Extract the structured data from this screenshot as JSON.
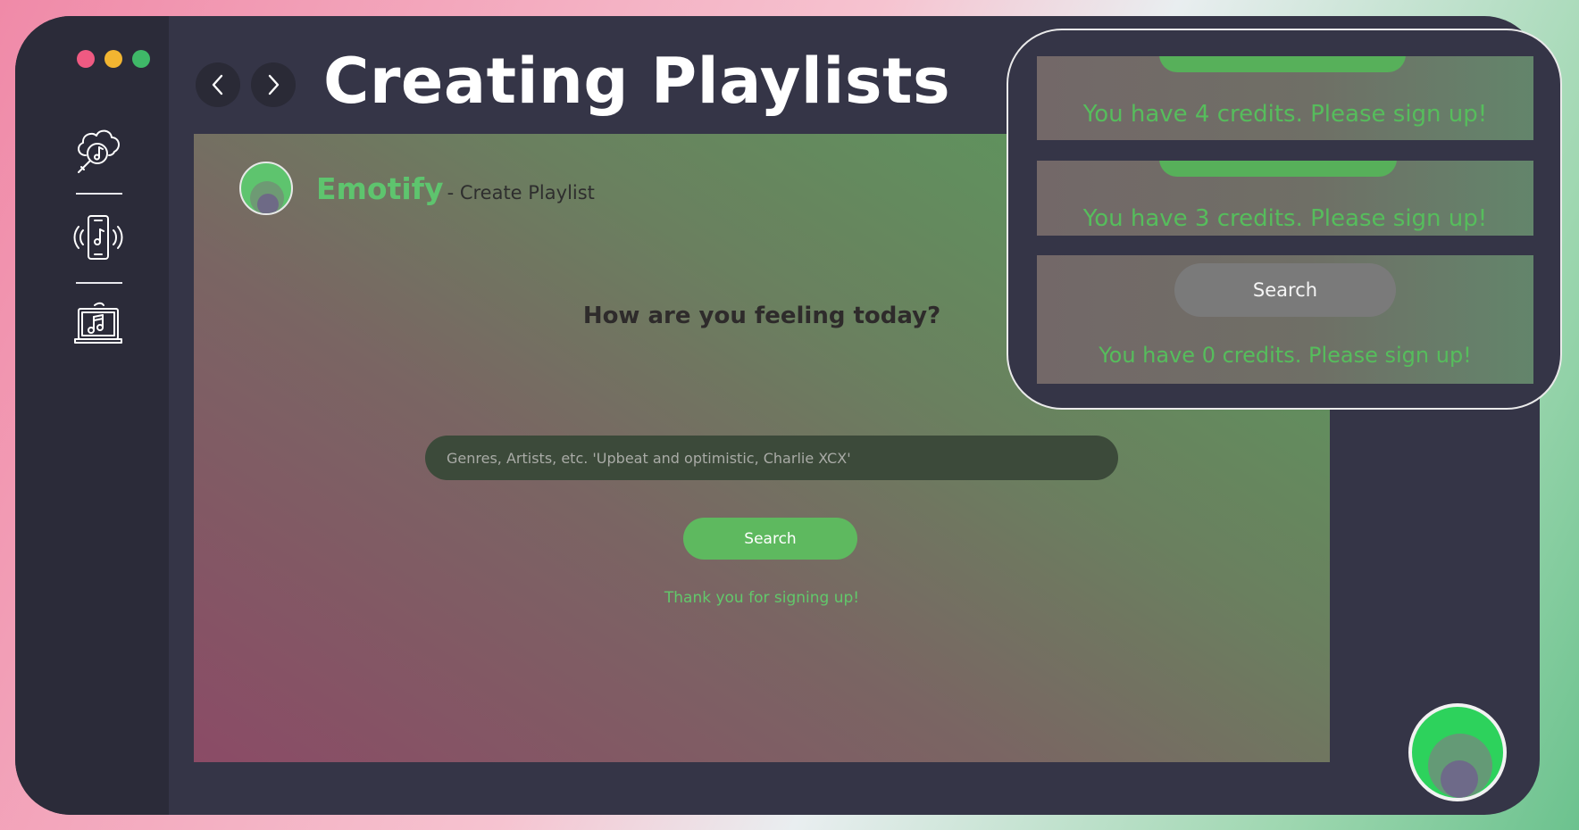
{
  "window": {
    "title": "Creating Playlists",
    "controls": [
      "close",
      "minimize",
      "maximize"
    ]
  },
  "sidebar": {
    "items": [
      {
        "icon": "cloud-music-search-icon",
        "label": ""
      },
      {
        "icon": "phone-music-icon",
        "label": ""
      },
      {
        "icon": "laptop-music-icon",
        "label": ""
      }
    ]
  },
  "nav": {
    "back_icon": "chevron-left-icon",
    "forward_icon": "chevron-right-icon"
  },
  "app": {
    "brand": "Emotify",
    "brand_suffix": " - Create Playlist",
    "question": "How are you feeling today?",
    "search_placeholder": "Genres, Artists, etc. 'Upbeat and optimistic, Charlie XCX'",
    "search_value": "",
    "search_label": "Search",
    "thank_you": "Thank you for signing up!"
  },
  "zoom_panels": [
    {
      "credits_text": "You have 4 credits. Please sign up!"
    },
    {
      "credits_text": "You have 3 credits. Please sign up!"
    },
    {
      "button_label": "Search",
      "credits_text": "You have 0 credits. Please sign up!"
    }
  ],
  "colors": {
    "accent_green": "#5ec46e",
    "window_bg": "#353547",
    "sidebar_bg": "#2b2b39",
    "credit_text": "#56bd5c"
  }
}
